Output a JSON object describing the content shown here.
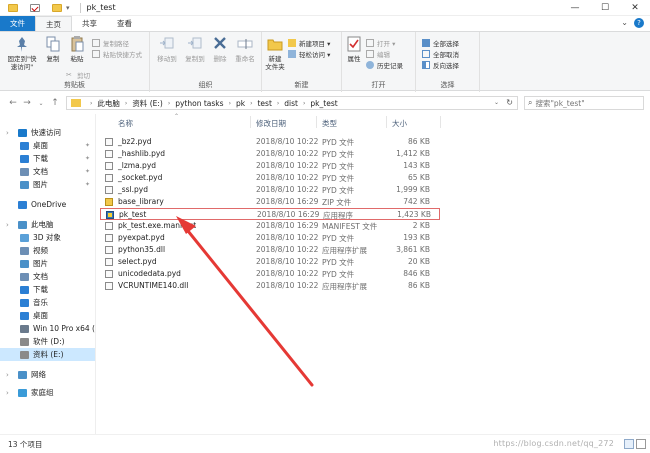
{
  "window": {
    "title": "pk_test",
    "controls": [
      "—",
      "☐",
      "✕"
    ]
  },
  "ribbon_tabs": [
    {
      "label": "文件",
      "kind": "file"
    },
    {
      "label": "主页",
      "kind": "active"
    },
    {
      "label": "共享",
      "kind": "normal"
    },
    {
      "label": "查看",
      "kind": "normal"
    }
  ],
  "ribbon": {
    "clipboard": {
      "label": "剪贴板",
      "pin": "固定到\"快\n速访问\"",
      "copy": "复制",
      "paste": "粘贴",
      "copy_path": "复制路径",
      "paste_shortcut": "粘贴快捷方式",
      "cut": "剪切"
    },
    "organize": {
      "label": "组织",
      "move_to": "移动到",
      "copy_to": "复制到",
      "delete": "删除",
      "rename": "重命名"
    },
    "new": {
      "label": "新建",
      "new_folder": "新建\n文件夹",
      "new_item": "新建项目 ▾",
      "easy_access": "轻松访问 ▾"
    },
    "open": {
      "label": "打开",
      "properties": "属性",
      "open": "打开 ▾",
      "edit": "编辑",
      "history": "历史记录"
    },
    "select": {
      "label": "选择",
      "select_all": "全部选择",
      "select_none": "全部取消",
      "invert": "反向选择"
    }
  },
  "address": {
    "crumbs": [
      "此电脑",
      "资料 (E:)",
      "python tasks",
      "pk",
      "test",
      "dist",
      "pk_test"
    ],
    "search_placeholder": "搜索\"pk_test\""
  },
  "nav": {
    "items": [
      {
        "label": "快速访问",
        "icon": "star-icon",
        "color": "#1979ca",
        "indent": 0,
        "pinned": false,
        "selected": false
      },
      {
        "label": "桌面",
        "icon": "desktop-icon",
        "color": "#2b7fd4",
        "indent": 1,
        "pinned": true,
        "selected": false
      },
      {
        "label": "下载",
        "icon": "download-icon",
        "color": "#2b7fd4",
        "indent": 1,
        "pinned": true,
        "selected": false
      },
      {
        "label": "文档",
        "icon": "document-icon",
        "color": "#6d8fb5",
        "indent": 1,
        "pinned": true,
        "selected": false
      },
      {
        "label": "图片",
        "icon": "picture-icon",
        "color": "#4a90c8",
        "indent": 1,
        "pinned": true,
        "selected": false
      },
      {
        "label": "OneDrive",
        "icon": "cloud-icon",
        "color": "#2b7fd4",
        "indent": 0,
        "pinned": false,
        "selected": false
      },
      {
        "label": "此电脑",
        "icon": "computer-icon",
        "color": "#4a90c8",
        "indent": 0,
        "pinned": false,
        "selected": false
      },
      {
        "label": "3D 对象",
        "icon": "cube-icon",
        "color": "#5aa0d8",
        "indent": 1,
        "pinned": false,
        "selected": false
      },
      {
        "label": "视频",
        "icon": "video-icon",
        "color": "#6d8fb5",
        "indent": 1,
        "pinned": false,
        "selected": false
      },
      {
        "label": "图片",
        "icon": "picture-icon",
        "color": "#4a90c8",
        "indent": 1,
        "pinned": false,
        "selected": false
      },
      {
        "label": "文档",
        "icon": "document-icon",
        "color": "#6d8fb5",
        "indent": 1,
        "pinned": false,
        "selected": false
      },
      {
        "label": "下载",
        "icon": "download-icon",
        "color": "#2b7fd4",
        "indent": 1,
        "pinned": false,
        "selected": false
      },
      {
        "label": "音乐",
        "icon": "music-icon",
        "color": "#2b7fd4",
        "indent": 1,
        "pinned": false,
        "selected": false
      },
      {
        "label": "桌面",
        "icon": "desktop-icon",
        "color": "#2b7fd4",
        "indent": 1,
        "pinned": false,
        "selected": false
      },
      {
        "label": "Win 10 Pro x64 (C",
        "icon": "drive-icon",
        "color": "#6a7a8c",
        "indent": 1,
        "pinned": false,
        "selected": false
      },
      {
        "label": "软件 (D:)",
        "icon": "drive-icon",
        "color": "#8a8a8a",
        "indent": 1,
        "pinned": false,
        "selected": false
      },
      {
        "label": "资料 (E:)",
        "icon": "drive-icon",
        "color": "#8a8a8a",
        "indent": 1,
        "pinned": false,
        "selected": true
      },
      {
        "label": "网络",
        "icon": "network-icon",
        "color": "#4a90c8",
        "indent": 0,
        "pinned": false,
        "selected": false
      },
      {
        "label": "家庭组",
        "icon": "homegroup-icon",
        "color": "#3a9bd8",
        "indent": 0,
        "pinned": false,
        "selected": false
      }
    ]
  },
  "columns": {
    "name": "名称",
    "date": "修改日期",
    "type": "类型",
    "size": "大小"
  },
  "files": [
    {
      "name": "_bz2.pyd",
      "date": "2018/8/10 10:22",
      "type": "PYD 文件",
      "size": "86 KB",
      "icon": "file-icon",
      "selected": false
    },
    {
      "name": "_hashlib.pyd",
      "date": "2018/8/10 10:22",
      "type": "PYD 文件",
      "size": "1,412 KB",
      "icon": "file-icon",
      "selected": false
    },
    {
      "name": "_lzma.pyd",
      "date": "2018/8/10 10:22",
      "type": "PYD 文件",
      "size": "143 KB",
      "icon": "file-icon",
      "selected": false
    },
    {
      "name": "_socket.pyd",
      "date": "2018/8/10 10:22",
      "type": "PYD 文件",
      "size": "65 KB",
      "icon": "file-icon",
      "selected": false
    },
    {
      "name": "_ssl.pyd",
      "date": "2018/8/10 10:22",
      "type": "PYD 文件",
      "size": "1,999 KB",
      "icon": "file-icon",
      "selected": false
    },
    {
      "name": "base_library",
      "date": "2018/8/10 16:29",
      "type": "ZIP 文件",
      "size": "742 KB",
      "icon": "zip-icon",
      "selected": false
    },
    {
      "name": "pk_test",
      "date": "2018/8/10 16:29",
      "type": "应用程序",
      "size": "1,423 KB",
      "icon": "exe-icon",
      "selected": true
    },
    {
      "name": "pk_test.exe.manifest",
      "date": "2018/8/10 16:29",
      "type": "MANIFEST 文件",
      "size": "2 KB",
      "icon": "file-icon",
      "selected": false
    },
    {
      "name": "pyexpat.pyd",
      "date": "2018/8/10 10:22",
      "type": "PYD 文件",
      "size": "193 KB",
      "icon": "file-icon",
      "selected": false
    },
    {
      "name": "python35.dll",
      "date": "2018/8/10 10:22",
      "type": "应用程序扩展",
      "size": "3,861 KB",
      "icon": "file-icon",
      "selected": false
    },
    {
      "name": "select.pyd",
      "date": "2018/8/10 10:22",
      "type": "PYD 文件",
      "size": "20 KB",
      "icon": "file-icon",
      "selected": false
    },
    {
      "name": "unicodedata.pyd",
      "date": "2018/8/10 10:22",
      "type": "PYD 文件",
      "size": "846 KB",
      "icon": "file-icon",
      "selected": false
    },
    {
      "name": "VCRUNTIME140.dll",
      "date": "2018/8/10 10:22",
      "type": "应用程序扩展",
      "size": "86 KB",
      "icon": "file-icon",
      "selected": false
    }
  ],
  "status": {
    "count": "13 个项目",
    "watermark": "https://blog.csdn.net/qq_272"
  },
  "colors": {
    "accent": "#1979ca",
    "selection_border": "#e06a6a",
    "annotation_arrow": "#e53935"
  }
}
